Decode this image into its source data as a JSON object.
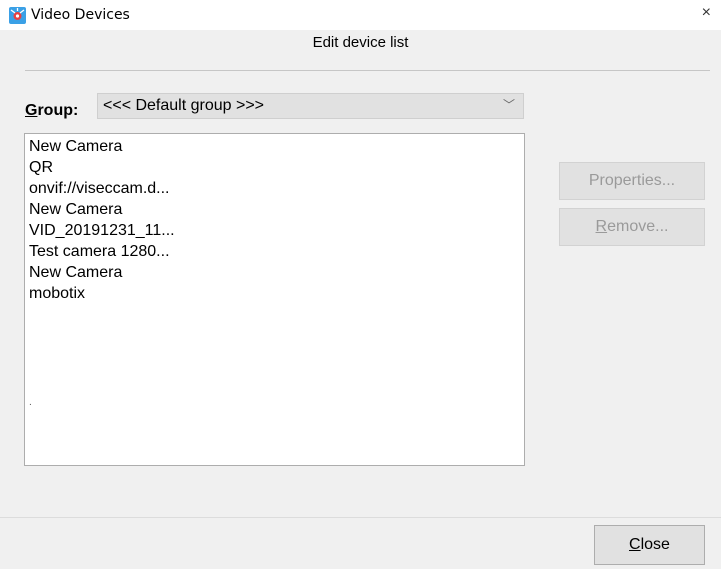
{
  "window": {
    "title": "Video Devices",
    "close_glyph": "×",
    "app_icon": "video-devices-app-icon"
  },
  "heading": "Edit device list",
  "group": {
    "label_accel": "G",
    "label_rest": "roup:",
    "selected": "<<< Default group >>>",
    "arrow_glyph": "﹀"
  },
  "devices": [
    "New Camera",
    "QR",
    "onvif://viseccam.d...",
    "New Camera",
    "VID_20191231_11...",
    "Test camera 1280...",
    "New Camera",
    "mobotix"
  ],
  "list_trailing_mark": ".",
  "buttons": {
    "properties": "Properties...",
    "remove_accel": "R",
    "remove_rest": "emove...",
    "close_accel": "C",
    "close_rest": "lose"
  },
  "colors": {
    "dialog_bg": "#f0f0f0",
    "disabled_text": "#9a9a9a",
    "button_bg": "#e1e1e1"
  }
}
